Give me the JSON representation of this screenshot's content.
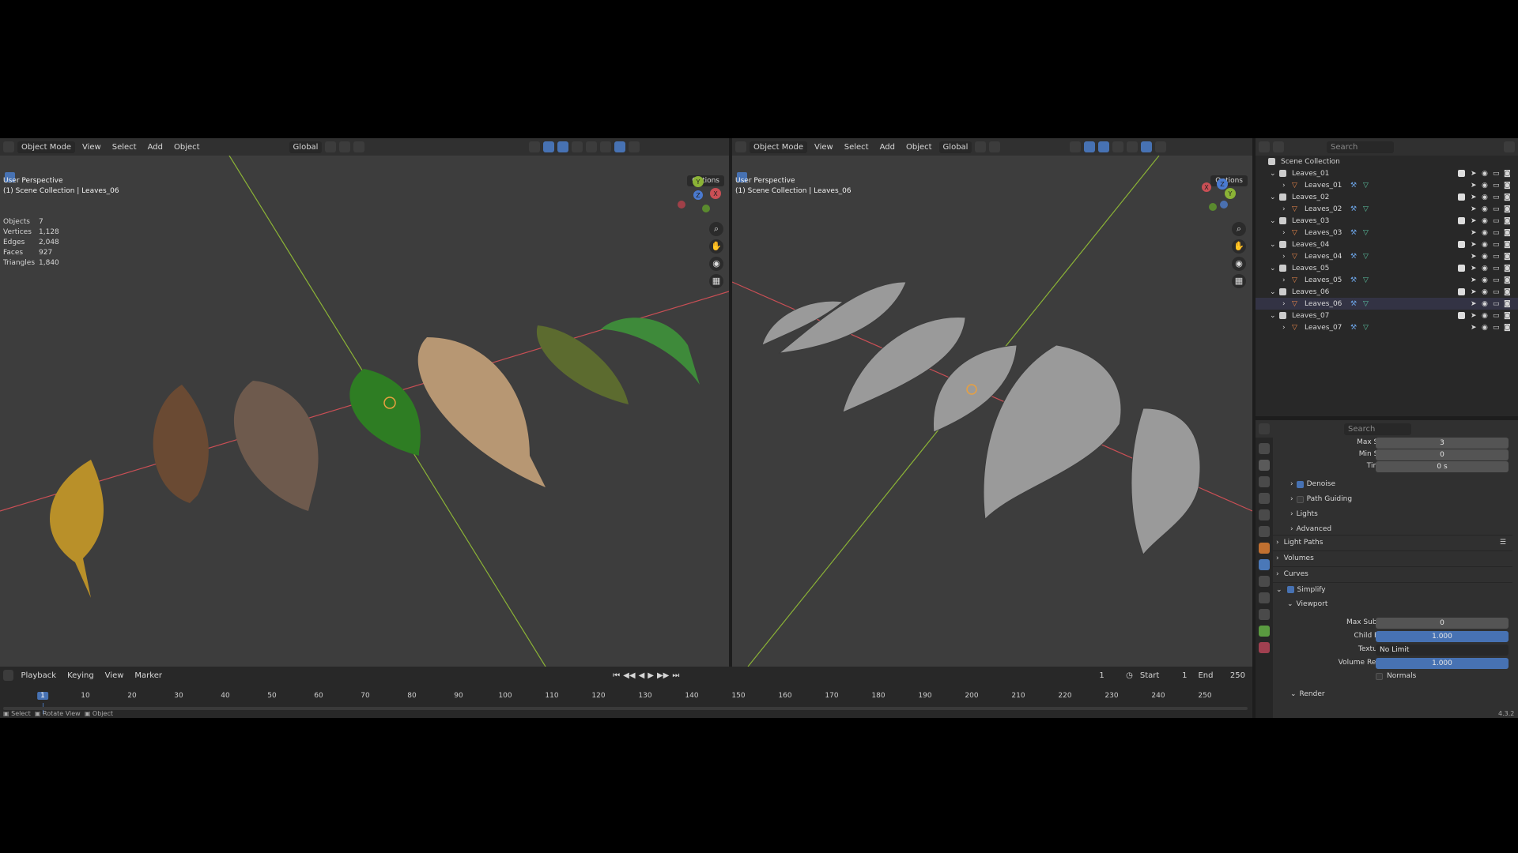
{
  "viewport_left": {
    "mode": "Object Mode",
    "menus": [
      "View",
      "Select",
      "Add",
      "Object"
    ],
    "orientation": "Global",
    "options": "Options",
    "perspective": "User Perspective",
    "collection": "(1) Scene Collection | Leaves_06",
    "stats": [
      {
        "k": "Objects",
        "v": "7"
      },
      {
        "k": "Vertices",
        "v": "1,128"
      },
      {
        "k": "Edges",
        "v": "2,048"
      },
      {
        "k": "Faces",
        "v": "927"
      },
      {
        "k": "Triangles",
        "v": "1,840"
      }
    ],
    "gizmo": {
      "x": "X",
      "y": "Y",
      "z": "Z"
    }
  },
  "viewport_right": {
    "mode": "Object Mode",
    "menus": [
      "View",
      "Select",
      "Add",
      "Object"
    ],
    "orientation": "Global",
    "options": "Options",
    "perspective": "User Perspective",
    "collection": "(1) Scene Collection | Leaves_06",
    "gizmo": {
      "x": "X",
      "y": "Y",
      "z": "Z"
    }
  },
  "outliner": {
    "search_placeholder": "Search",
    "root": "Scene Collection",
    "items": [
      {
        "collection": "Leaves_01",
        "object": "Leaves_01"
      },
      {
        "collection": "Leaves_02",
        "object": "Leaves_02"
      },
      {
        "collection": "Leaves_03",
        "object": "Leaves_03"
      },
      {
        "collection": "Leaves_04",
        "object": "Leaves_04"
      },
      {
        "collection": "Leaves_05",
        "object": "Leaves_05"
      },
      {
        "collection": "Leaves_06",
        "object": "Leaves_06"
      },
      {
        "collection": "Leaves_07",
        "object": "Leaves_07"
      }
    ]
  },
  "properties": {
    "search_placeholder": "Search",
    "max_samples": {
      "label": "Max Samples",
      "value": "3"
    },
    "min_samples": {
      "label": "Min Samples",
      "value": "0"
    },
    "time_limit": {
      "label": "Time Limit",
      "value": "0 s"
    },
    "denoise": "Denoise",
    "path_guiding": "Path Guiding",
    "lights": "Lights",
    "advanced": "Advanced",
    "light_paths": "Light Paths",
    "volumes": "Volumes",
    "curves": "Curves",
    "simplify": "Simplify",
    "viewport": "Viewport",
    "max_subdivision": {
      "label": "Max Subdivision",
      "value": "0"
    },
    "child_particles": {
      "label": "Child Particles",
      "value": "1.000"
    },
    "texture_limit": {
      "label": "Texture Limit",
      "value": "No Limit"
    },
    "volume_resolution": {
      "label": "Volume Resolution",
      "value": "1.000"
    },
    "normals": "Normals",
    "render": "Render"
  },
  "timeline": {
    "menus": [
      "Playback",
      "Keying",
      "View",
      "Marker"
    ],
    "current_frame": "1",
    "start_label": "Start",
    "start": "1",
    "end_label": "End",
    "end": "250",
    "ticks": [
      "1",
      "10",
      "20",
      "30",
      "40",
      "50",
      "60",
      "70",
      "80",
      "90",
      "100",
      "110",
      "120",
      "130",
      "140",
      "150",
      "160",
      "170",
      "180",
      "190",
      "200",
      "210",
      "220",
      "230",
      "240",
      "250"
    ]
  },
  "statusbar": {
    "select": "Select",
    "rotate": "Rotate View",
    "object": "Object",
    "version": "4.3.2"
  },
  "colors": {
    "accent": "#4772b3",
    "viewport_bg": "#3d3d3d",
    "panel_bg": "#303030",
    "x_axis": "#c94f55",
    "y_axis": "#8bb336",
    "object_orange": "#e8874a"
  }
}
